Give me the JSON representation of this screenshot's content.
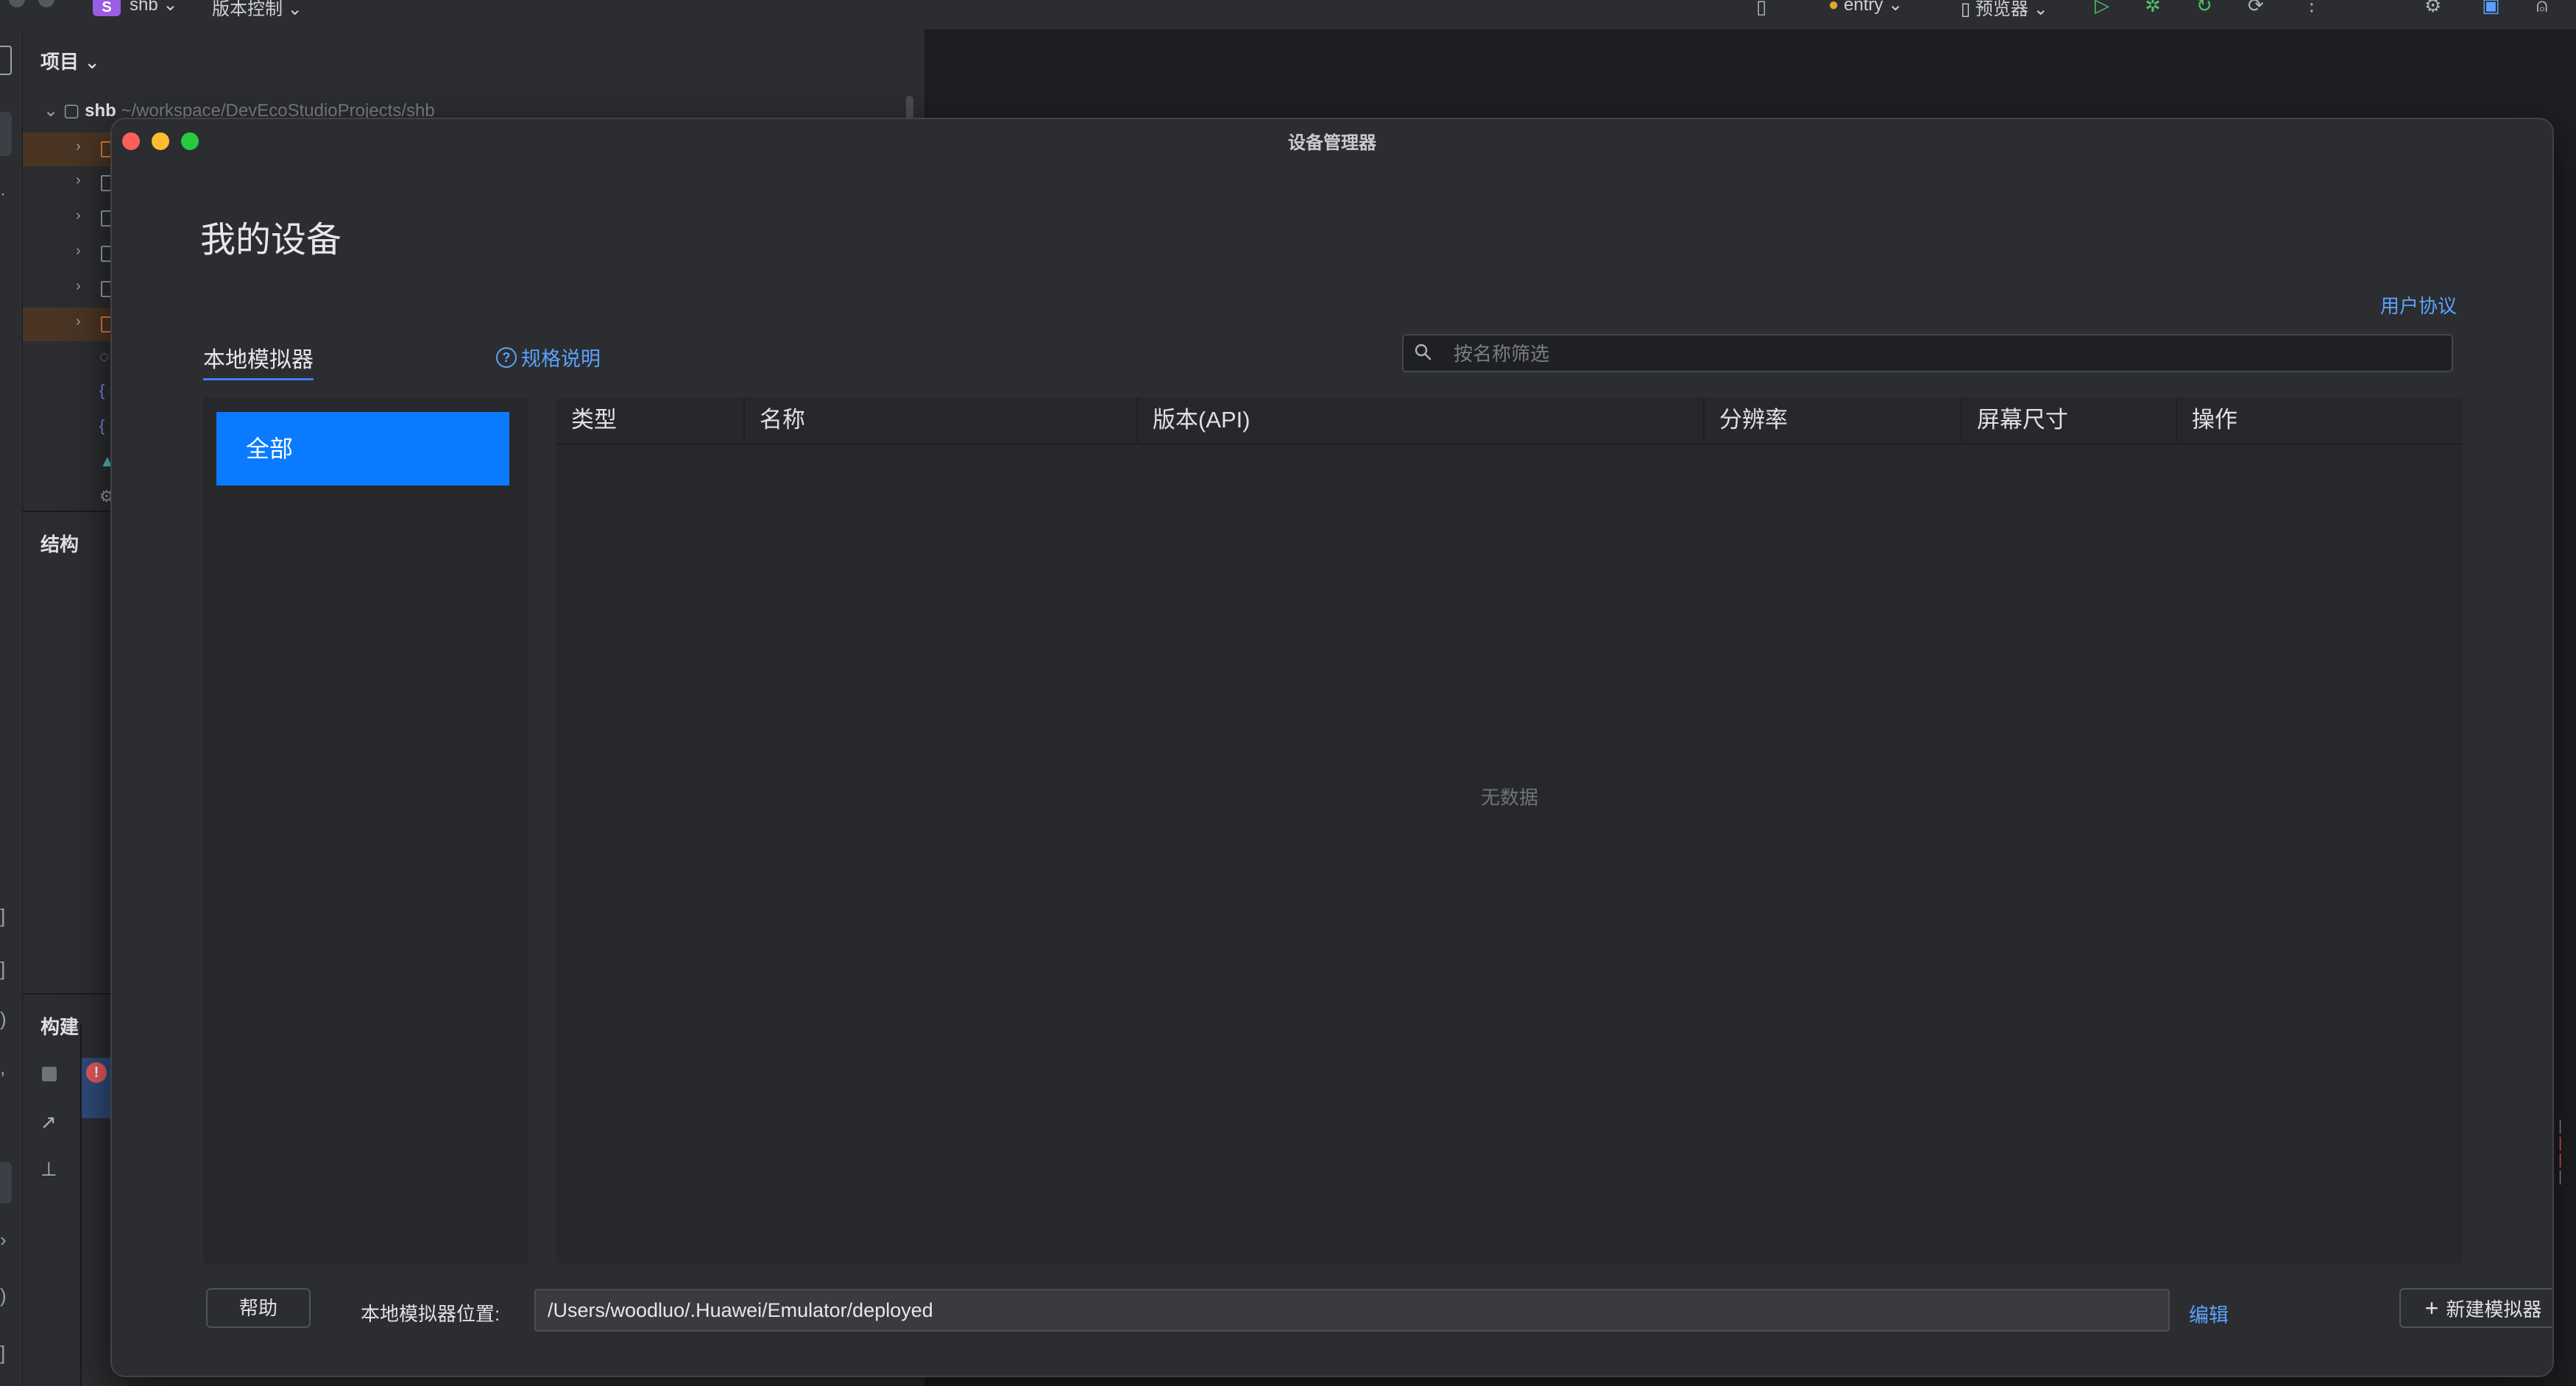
{
  "ide": {
    "project_badge": "S",
    "project_name": "shb",
    "vcs_menu": "版本控制",
    "run_config": "entry",
    "preview_menu": "预览器",
    "project_panel_title": "项目",
    "tree_root_name": "shb",
    "tree_root_path": "~/workspace/DevEcoStudioProjects/shb",
    "structure_panel_title": "结构",
    "build_panel_title": "构建",
    "build_error_badge": "!"
  },
  "dialog": {
    "title": "设备管理器",
    "heading": "我的设备",
    "user_agreement": "用户协议",
    "tabs": {
      "local_emulator": "本地模拟器"
    },
    "spec_link": "规格说明",
    "search": {
      "placeholder": "按名称筛选",
      "value": ""
    },
    "categories": [
      "全部"
    ],
    "table": {
      "columns": [
        "类型",
        "名称",
        "版本(API)",
        "分辨率",
        "屏幕尺寸",
        "操作"
      ],
      "empty_text": "无数据"
    },
    "footer": {
      "help_label": "帮助",
      "location_label": "本地模拟器位置:",
      "location_value": "/Users/woodluo/.Huawei/Emulator/deployed",
      "edit_label": "编辑",
      "new_emulator_label": "新建模拟器"
    }
  },
  "colors": {
    "accent": "#0a7bff",
    "link": "#5ca1ff",
    "dialog_bg": "#2b2d30",
    "panel_bg": "#27282c"
  }
}
